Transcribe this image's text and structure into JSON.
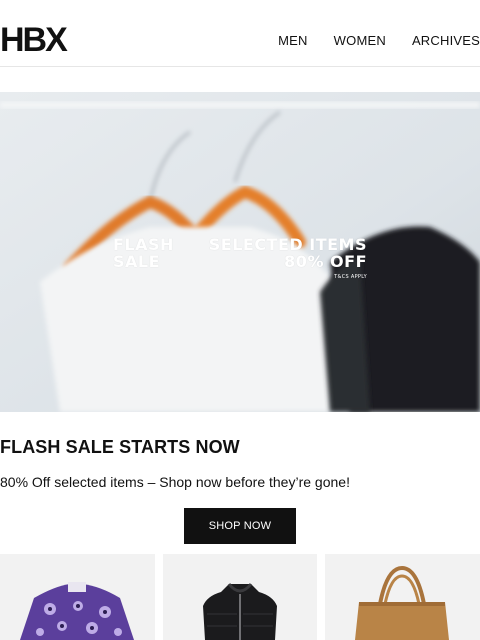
{
  "header": {
    "logo": "HBX",
    "nav": [
      "MEN",
      "WOMEN",
      "ARCHIVES"
    ]
  },
  "hero": {
    "flash_line1": "FLASH",
    "flash_line2": "SALE",
    "offer_line1": "SELECTED ITEMS",
    "offer_line2": "80% OFF",
    "terms": "T&CS APPLY"
  },
  "promo": {
    "headline": "FLASH SALE STARTS NOW",
    "subline": "80% Off selected items – Shop now before they’re gone!",
    "cta_label": "SHOP NOW"
  },
  "products": [
    {
      "icon": "purple-print-shirt-image"
    },
    {
      "icon": "black-vest-image"
    },
    {
      "icon": "tan-tote-bag-image"
    }
  ],
  "colors": {
    "accent": "#111111",
    "hero_bg": "#dfe4e9",
    "hanger": "#e07a2a"
  }
}
